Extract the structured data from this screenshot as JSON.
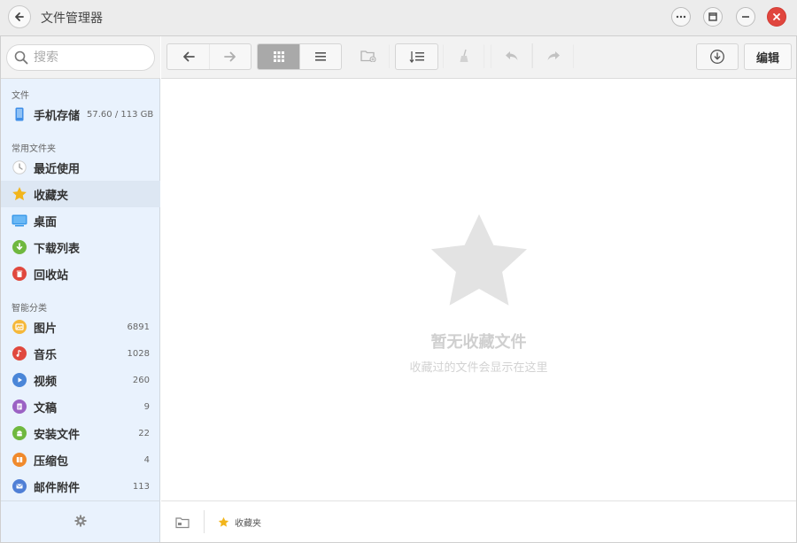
{
  "window": {
    "title": "文件管理器"
  },
  "search": {
    "placeholder": "搜索"
  },
  "sidebar": {
    "files_section": "文件",
    "storage": {
      "label": "手机存储",
      "size": "57.60 / 113 GB"
    },
    "common_section": "常用文件夹",
    "common_items": [
      {
        "label": "最近使用",
        "icon": "clock-icon"
      },
      {
        "label": "收藏夹",
        "icon": "star-icon",
        "selected": true
      },
      {
        "label": "桌面",
        "icon": "desktop-icon"
      },
      {
        "label": "下载列表",
        "icon": "download-icon"
      },
      {
        "label": "回收站",
        "icon": "trash-icon"
      }
    ],
    "smart_section": "智能分类",
    "smart_items": [
      {
        "label": "图片",
        "count": "6891",
        "icon": "image-icon",
        "color": "#f5b83a"
      },
      {
        "label": "音乐",
        "count": "1028",
        "icon": "music-icon",
        "color": "#e0483e"
      },
      {
        "label": "视频",
        "count": "260",
        "icon": "video-icon",
        "color": "#4a86d8"
      },
      {
        "label": "文稿",
        "count": "9",
        "icon": "document-icon",
        "color": "#9b62c4"
      },
      {
        "label": "安装文件",
        "count": "22",
        "icon": "android-icon",
        "color": "#6fb83f"
      },
      {
        "label": "压缩包",
        "count": "4",
        "icon": "archive-icon",
        "color": "#f08a2c"
      },
      {
        "label": "邮件附件",
        "count": "113",
        "icon": "mail-icon",
        "color": "#4f7fd6"
      }
    ]
  },
  "toolbar": {
    "edit_label": "编辑",
    "view_mode": "grid"
  },
  "empty_state": {
    "title": "暂无收藏文件",
    "subtitle": "收藏过的文件会显示在这里"
  },
  "statusbar": {
    "crumb_label": "收藏夹"
  },
  "colors": {
    "sidebar_bg": "#e9f2fd",
    "selected_bg": "#dde7f3",
    "close_button": "#e0463e",
    "star": "#f2b51b"
  }
}
